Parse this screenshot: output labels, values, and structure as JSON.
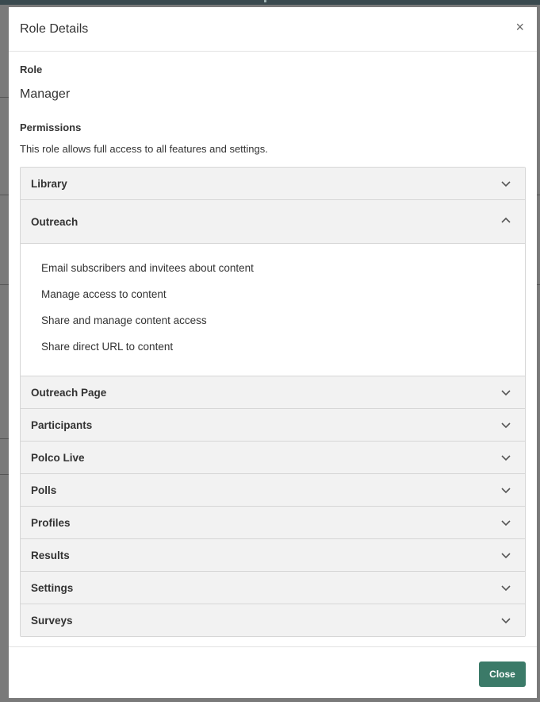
{
  "modal": {
    "title": "Role Details",
    "close_symbol": "×"
  },
  "role": {
    "label": "Role",
    "value": "Manager"
  },
  "permissions": {
    "label": "Permissions",
    "description": "This role allows full access to all features and settings."
  },
  "sections": [
    {
      "title": "Library",
      "expanded": false,
      "icon": "chevron-down-icon"
    },
    {
      "title": "Outreach",
      "expanded": true,
      "icon": "chevron-up-icon",
      "items": [
        "Email subscribers and invitees about content",
        "Manage access to content",
        "Share and manage content access",
        "Share direct URL to content"
      ]
    },
    {
      "title": "Outreach Page",
      "expanded": false,
      "icon": "chevron-down-icon"
    },
    {
      "title": "Participants",
      "expanded": false,
      "icon": "chevron-down-icon"
    },
    {
      "title": "Polco Live",
      "expanded": false,
      "icon": "chevron-down-icon"
    },
    {
      "title": "Polls",
      "expanded": false,
      "icon": "chevron-down-icon"
    },
    {
      "title": "Profiles",
      "expanded": false,
      "icon": "chevron-down-icon"
    },
    {
      "title": "Results",
      "expanded": false,
      "icon": "chevron-down-icon"
    },
    {
      "title": "Settings",
      "expanded": false,
      "icon": "chevron-down-icon"
    },
    {
      "title": "Surveys",
      "expanded": false,
      "icon": "chevron-down-icon"
    }
  ],
  "footer": {
    "close_label": "Close"
  },
  "colors": {
    "primary_button": "#3b7a68",
    "header_bg": "#f2f2f2",
    "backdrop": "#7a7a7a"
  }
}
